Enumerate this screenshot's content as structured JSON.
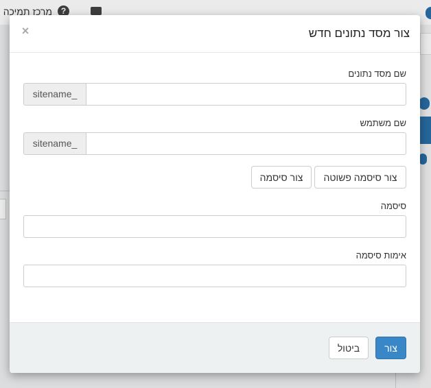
{
  "background": {
    "help_label": "מרכז תמיכה",
    "help_icon_glyph": "?"
  },
  "modal": {
    "title": "צור מסד נתונים חדש",
    "close_glyph": "×",
    "db_name": {
      "label": "שם מסד נתונים",
      "prefix": "sitename_",
      "value": "",
      "placeholder": ""
    },
    "username": {
      "label": "שם משתמש",
      "prefix": "sitename_",
      "value": "",
      "placeholder": ""
    },
    "buttons": {
      "simple_password": "צור סיסמה פשוטה",
      "generate_password": "צור סיסמה"
    },
    "password": {
      "label": "סיסמה",
      "value": ""
    },
    "confirm_password": {
      "label": "אימות סיסמה",
      "value": ""
    },
    "footer": {
      "create": "צור",
      "cancel": "ביטול"
    }
  },
  "colors": {
    "primary": "#3a87c8",
    "footer_bg": "#edf1f2",
    "addon_bg": "#eeeeee"
  },
  "icons": [
    "help-icon",
    "chat-icon",
    "close-icon"
  ]
}
